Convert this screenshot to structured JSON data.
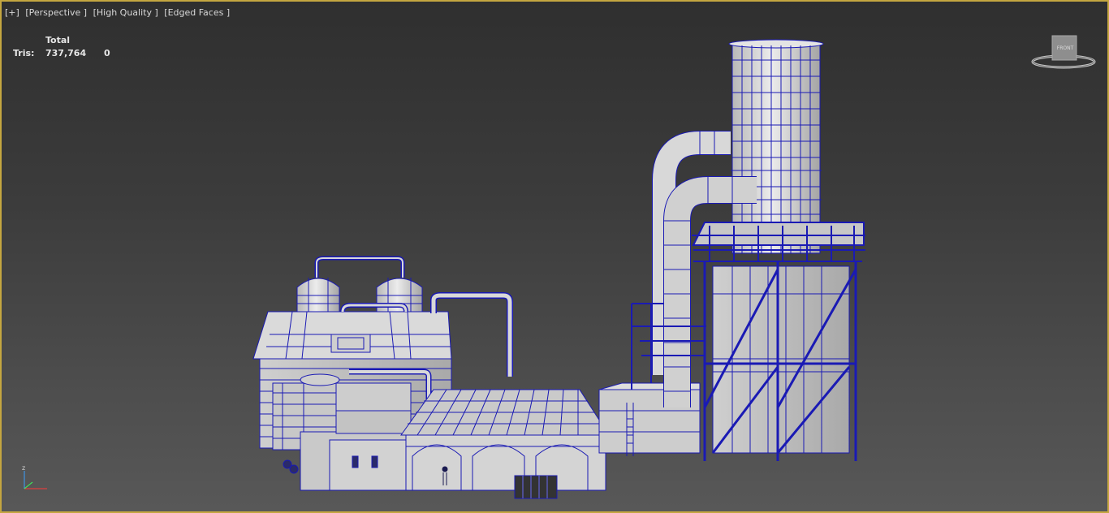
{
  "viewport": {
    "labels": [
      "[+]",
      "[Perspective ]",
      "[High Quality ]",
      "[Edged Faces ]"
    ]
  },
  "stats": {
    "header": "Total",
    "rows": [
      {
        "label": "Tris:",
        "total": "737,764",
        "selected": "0"
      }
    ]
  },
  "viewcube": {
    "face_label": "FRONT"
  },
  "axis_gizmo": {
    "z_label": "z"
  },
  "colors": {
    "frame": "#c4a640",
    "wireframe": "#1a1ab4",
    "model_fill": "#d8d8d8"
  }
}
